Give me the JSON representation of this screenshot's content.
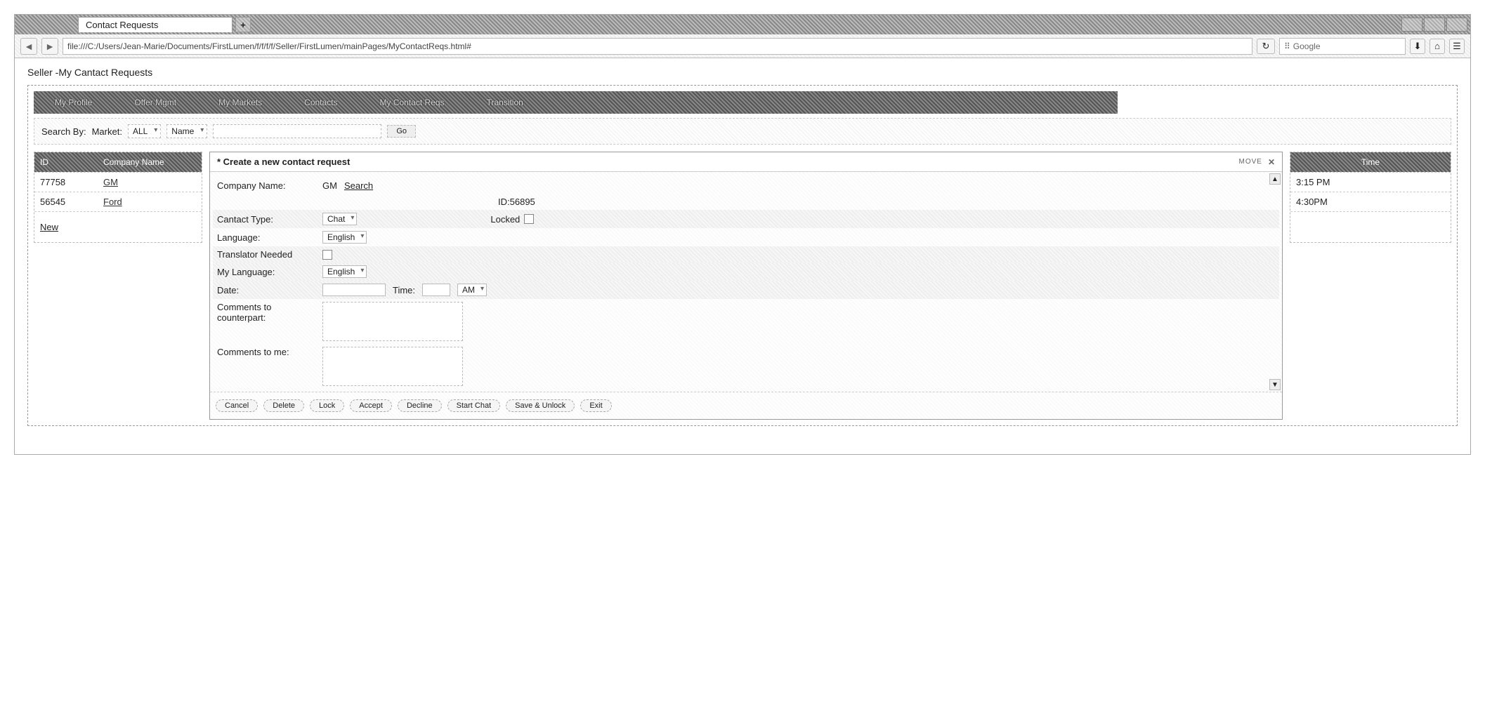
{
  "browser": {
    "tab_title": "Contact Requests",
    "url": "file:///C:/Users/Jean-Marie/Documents/FirstLumen/f/f/f/f/Seller/FirstLumen/mainPages/MyContactReqs.html#",
    "search_placeholder": "Google",
    "reload_glyph": "↻"
  },
  "page": {
    "title": "Seller -My Cantact Requests"
  },
  "navbar": {
    "items": [
      "My Profile",
      "Offer Mgmt",
      "My Markets",
      "Contacts",
      "My Contact Reqs",
      "Transition"
    ]
  },
  "search": {
    "label": "Search By:",
    "market_label": "Market:",
    "market_value": "ALL",
    "field_value": "Name",
    "go": "Go"
  },
  "table_left": {
    "cols": [
      "ID",
      "Company Name"
    ],
    "rows": [
      {
        "id": "77758",
        "company": "GM"
      },
      {
        "id": "56545",
        "company": "Ford"
      }
    ],
    "new": "New"
  },
  "table_right": {
    "col": "Time",
    "rows": [
      "3:15 PM",
      "4:30PM"
    ]
  },
  "dialog": {
    "title": "* Create a new contact request",
    "move": "MOVE",
    "company_label": "Company Name:",
    "company_value": "GM",
    "search_link": "Search",
    "id_label": "ID:",
    "id_value": "56895",
    "contact_type_label": "Cantact Type:",
    "contact_type_value": "Chat",
    "locked_label": "Locked",
    "language_label": "Language:",
    "language_value": "English",
    "translator_label": "Translator Needed",
    "my_language_label": "My Language:",
    "my_language_value": "English",
    "date_label": "Date:",
    "time_label": "Time:",
    "ampm_value": "AM",
    "comments_cp_label": "Comments to counterpart:",
    "comments_me_label": "Comments to me:",
    "buttons": [
      "Cancel",
      "Delete",
      "Lock",
      "Accept",
      "Decline",
      "Start Chat",
      "Save & Unlock",
      "Exit"
    ]
  }
}
